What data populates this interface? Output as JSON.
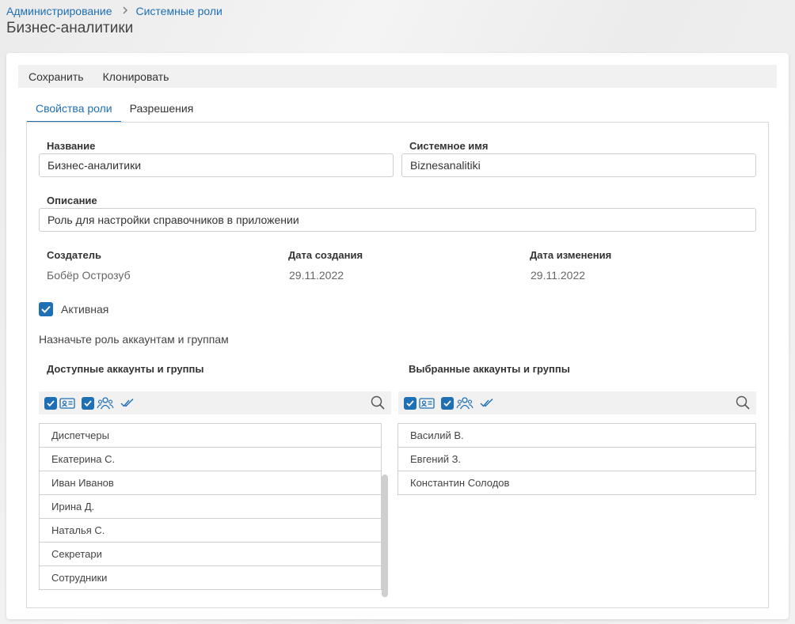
{
  "breadcrumb": {
    "root": "Администрирование",
    "current": "Системные роли"
  },
  "page_title": "Бизнес-аналитики",
  "toolbar": {
    "save_label": "Сохранить",
    "clone_label": "Клонировать"
  },
  "tabs": [
    {
      "label": "Свойства роли",
      "active": true
    },
    {
      "label": "Разрешения",
      "active": false
    }
  ],
  "form": {
    "name_label": "Название",
    "name_value": "Бизнес-аналитики",
    "sysname_label": "Системное имя",
    "sysname_value": "Biznesanalitiki",
    "description_label": "Описание",
    "description_value": "Роль для настройки справочников в приложении",
    "creator_label": "Создатель",
    "creator_value": "Бобёр Острозуб",
    "created_label": "Дата создания",
    "created_value": "29.11.2022",
    "modified_label": "Дата изменения",
    "modified_value": "29.11.2022",
    "active_label": "Активная",
    "active_checked": true
  },
  "assign_hint": "Назначьте роль аккаунтам и группам",
  "available": {
    "title": "Доступные аккаунты и группы",
    "items": [
      "Диспетчеры",
      "Екатерина С.",
      "Иван Иванов",
      "Ирина Д.",
      "Наталья С.",
      "Секретари",
      "Сотрудники"
    ]
  },
  "selected": {
    "title": "Выбранные аккаунты и группы",
    "items": [
      "Василий В.",
      "Евгений З.",
      "Константин Солодов"
    ]
  },
  "colors": {
    "accent": "#1e6fb4",
    "border": "#cfcfcf",
    "toolbar_bg": "#f1f1f1"
  }
}
